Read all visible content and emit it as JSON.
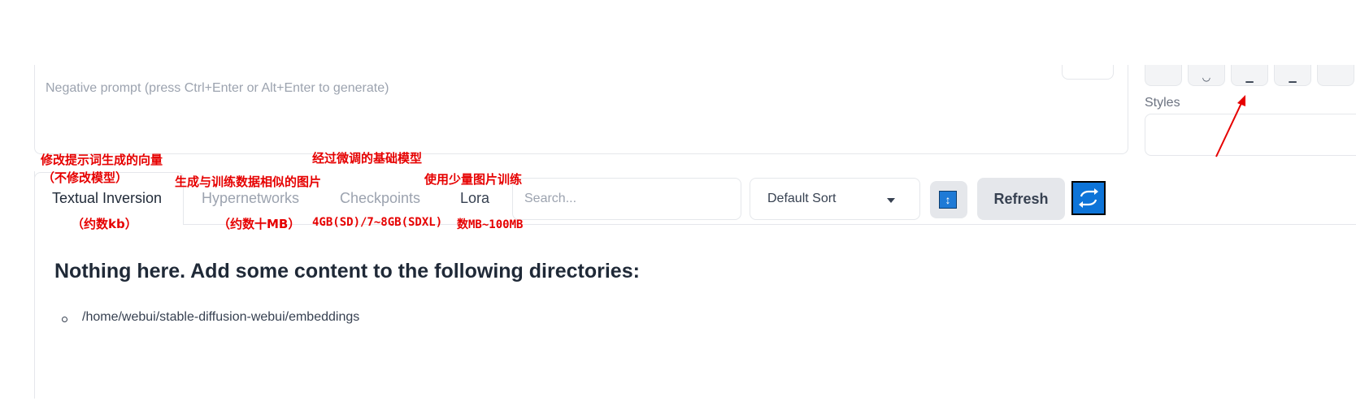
{
  "prompt": {
    "negative_placeholder": "Negative prompt (press Ctrl+Enter or Alt+Enter to generate)"
  },
  "styles": {
    "label": "Styles"
  },
  "tabs": [
    {
      "label": "Textual Inversion"
    },
    {
      "label": "Hypernetworks"
    },
    {
      "label": "Checkpoints"
    },
    {
      "label": "Lora"
    }
  ],
  "toolbar": {
    "search_placeholder": "Search...",
    "sort_value": "Default Sort",
    "direction_glyph": "↕",
    "refresh_label": "Refresh"
  },
  "content": {
    "heading": "Nothing here. Add some content to the following directories:",
    "directories": [
      "/home/webui/stable-diffusion-webui/embeddings"
    ]
  },
  "annotations": {
    "ti_line1": "修改提示词生成的向量",
    "ti_line2": "（不修改模型）",
    "ti_size": "（约数kb）",
    "hyper_line1": "生成与训练数据相似的图片",
    "hyper_size": "（约数十MB）",
    "ckpt_line1": "经过微调的基础模型",
    "ckpt_size": "4GB(SD)/7~8GB(SDXL)",
    "lora_line1": "使用少量图片训练",
    "lora_size": "数MB~100MB"
  },
  "colors": {
    "annotation": "#e60000",
    "accent_button": "#0d74d8"
  }
}
